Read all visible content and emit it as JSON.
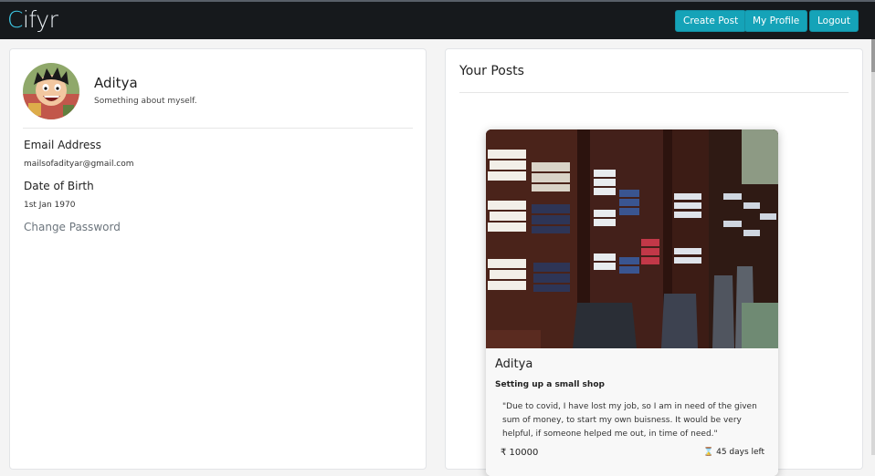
{
  "app": {
    "brand_first": "C",
    "brand_rest": "ifyr"
  },
  "nav": {
    "create_post": "Create Post",
    "my_profile": "My Profile",
    "logout": "Logout",
    "button_color": "#15a3b8"
  },
  "profile": {
    "name": "Aditya",
    "about": "Something about myself.",
    "email_label": "Email Address",
    "email_value": "mailsofadityar@gmail.com",
    "dob_label": "Date of Birth",
    "dob_value": "1st Jan 1970",
    "change_password": "Change Password"
  },
  "posts": {
    "title": "Your Posts",
    "items": [
      {
        "author": "Aditya",
        "title": "Setting up a small shop",
        "description": "\"Due to covid, I have lost my job, so I am in need of the given sum of money, to start my own buisness. It would be very helpful, if someone helped me out, in time of need.\"",
        "amount": "₹ 10000",
        "days_left": "45 days left"
      }
    ]
  }
}
